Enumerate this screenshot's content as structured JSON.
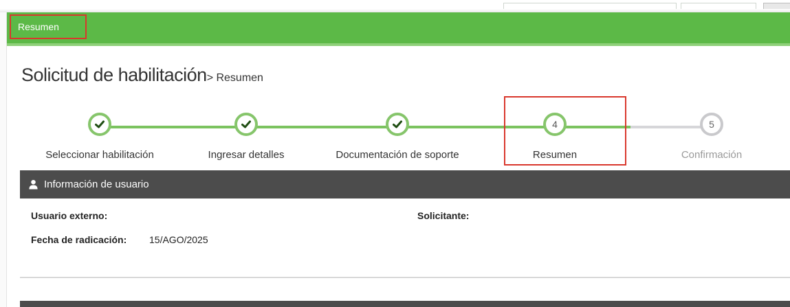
{
  "nav": {
    "tab_label": "Resumen"
  },
  "page": {
    "title": "Solicitud de habilitación",
    "breadcrumb": "> Resumen"
  },
  "stepper": {
    "steps": [
      {
        "label": "Seleccionar habilitación",
        "number": "1",
        "status": "done"
      },
      {
        "label": "Ingresar detalles",
        "number": "2",
        "status": "done"
      },
      {
        "label": "Documentación de soporte",
        "number": "3",
        "status": "done"
      },
      {
        "label": "Resumen",
        "number": "4",
        "status": "current"
      },
      {
        "label": "Confirmación",
        "number": "5",
        "status": "pending"
      }
    ]
  },
  "user_info": {
    "header": "Información de usuario",
    "external_user_label": "Usuario externo:",
    "external_user_value": "",
    "applicant_label": "Solicitante:",
    "applicant_value": "",
    "filing_date_label": "Fecha de radicación:",
    "filing_date_value": "15/AGO/2025"
  },
  "colors": {
    "nav_green": "#5cb947",
    "step_done": "#86c56b",
    "step_pending": "#c9c9cc",
    "panel_header": "#4c4c4c",
    "highlight_red": "#d9372c"
  }
}
